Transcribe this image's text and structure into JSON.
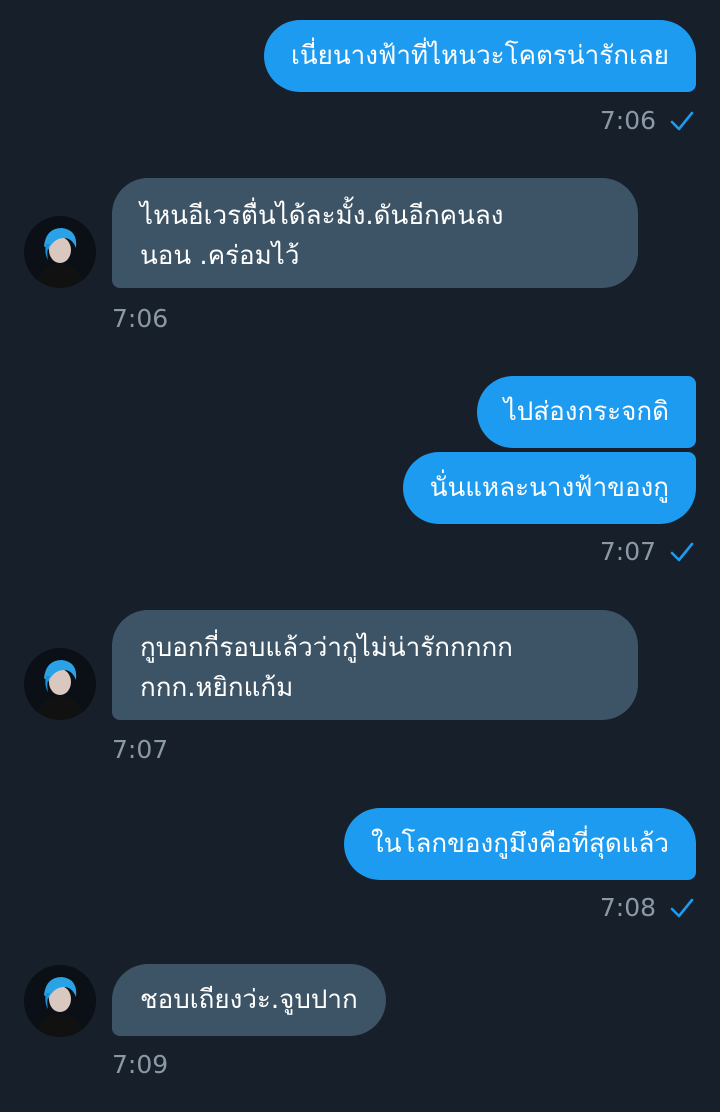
{
  "colors": {
    "background": "#17202a",
    "sent_bubble": "#1d9bf0",
    "received_bubble": "#3d5466",
    "timestamp": "#8b98a5",
    "read_check": "#1d9bf0"
  },
  "messages": [
    {
      "direction": "sent",
      "text": "เนี่ยนางฟ้าที่ไหนวะโคตรน่ารักเลย",
      "time": "7:06"
    },
    {
      "direction": "received",
      "lines": [
        "ไหนอีเวรตื่นได้ละมั้ง.ดันอีกคนลง",
        "นอน .คร่อมไว้"
      ],
      "time": "7:06"
    },
    {
      "direction": "sent",
      "text": "ไปส่องกระจกดิ"
    },
    {
      "direction": "sent",
      "text": "นั่นแหละนางฟ้าของกู",
      "time": "7:07"
    },
    {
      "direction": "received",
      "lines": [
        "กูบอกกี่รอบแล้วว่ากูไม่น่ารักกกกก",
        "กกก.หยิกแก้ม"
      ],
      "time": "7:07"
    },
    {
      "direction": "sent",
      "text": "ในโลกของกูมึงคือที่สุดแล้ว",
      "time": "7:08"
    },
    {
      "direction": "received",
      "text": "ชอบเถียงว่ะ.จูบปาก",
      "time": "7:09"
    }
  ],
  "icons": {
    "read_receipt": "check-icon",
    "avatar": "avatar"
  }
}
